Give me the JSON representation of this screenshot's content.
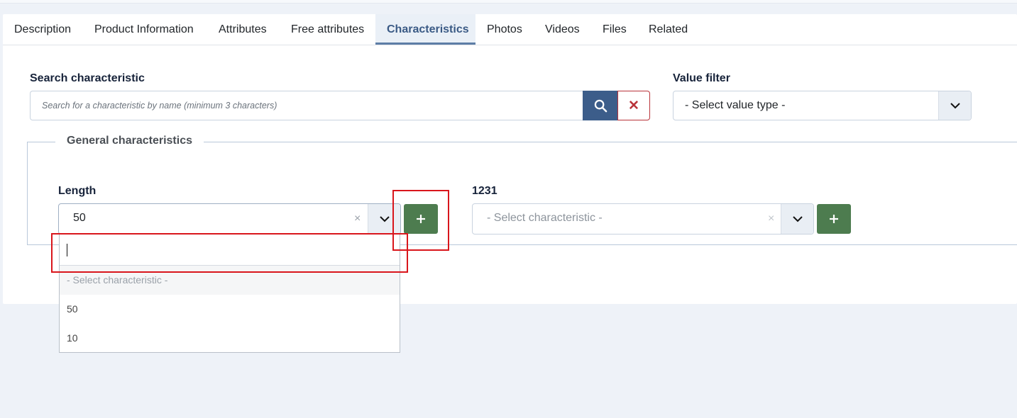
{
  "tabs": [
    {
      "label": "Description"
    },
    {
      "label": "Product Information"
    },
    {
      "label": "Attributes"
    },
    {
      "label": "Free attributes"
    },
    {
      "label": "Characteristics",
      "active": true
    },
    {
      "label": "Photos"
    },
    {
      "label": "Videos"
    },
    {
      "label": "Files"
    },
    {
      "label": "Related"
    }
  ],
  "search": {
    "label": "Search characteristic",
    "placeholder": "Search for a characteristic by name (minimum 3 characters)",
    "search_icon": "search-icon",
    "clear_symbol": "✕"
  },
  "value_filter": {
    "label": "Value filter",
    "selected": "- Select value type -"
  },
  "group": {
    "legend": "General characteristics",
    "fields": [
      {
        "label": "Length",
        "selected": "50",
        "clear": "×",
        "add": "+"
      },
      {
        "label": "1231",
        "selected": "- Select characteristic -",
        "clear": "×",
        "add": "+"
      }
    ]
  },
  "dropdown": {
    "search_value": "",
    "options": [
      "- Select characteristic -",
      "50",
      "10"
    ]
  },
  "colors": {
    "primary": "#3c5d8a",
    "success": "#4d7c4f",
    "danger": "#b9333a",
    "highlight": "#d9161c"
  }
}
